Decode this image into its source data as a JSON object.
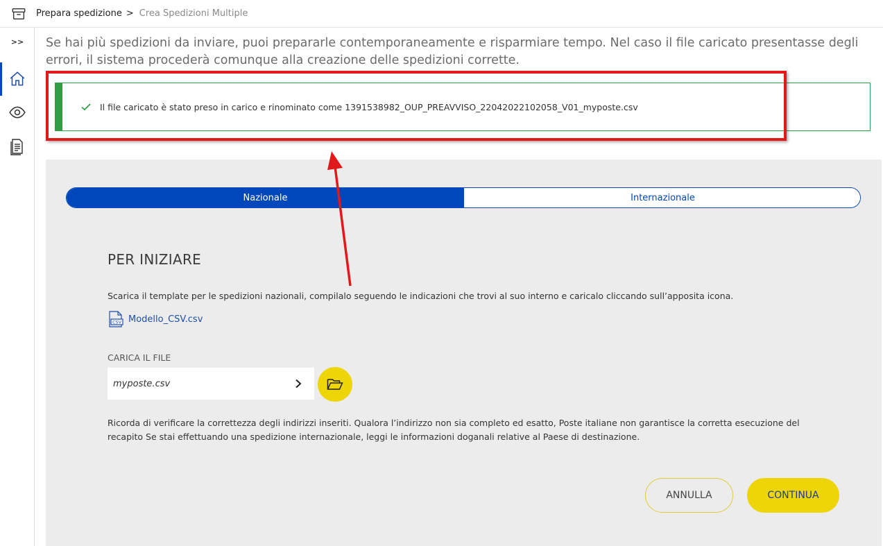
{
  "header": {
    "breadcrumb_main": "Prepara spedizione",
    "breadcrumb_sep": ">",
    "breadcrumb_current": "Crea Spedizioni Multiple",
    "icon": "archive-box-icon"
  },
  "sidebar": {
    "expand_label": ">>",
    "items": [
      {
        "icon": "home-icon",
        "active": true
      },
      {
        "icon": "eye-icon",
        "active": false
      },
      {
        "icon": "document-list-icon",
        "active": false
      }
    ]
  },
  "intro": {
    "text": "Se hai più spedizioni da inviare, puoi prepararle contemporaneamente e risparmiare tempo. Nel caso il file caricato presentasse degli errori, il sistema procederà comunque alla creazione delle spedizioni corrette."
  },
  "notification": {
    "type": "success",
    "message": "Il file caricato è stato preso in carico e rinominato come 1391538982_OUP_PREAVVISO_22042022102058_V01_myposte.csv",
    "icon": "check-icon"
  },
  "tabs": [
    {
      "label": "Nazionale",
      "active": true
    },
    {
      "label": "Internazionale",
      "active": false
    }
  ],
  "content": {
    "title": "PER INIZIARE",
    "description": "Scarica il template per le spedizioni nazionali, compilalo seguendo le indicazioni che trovi al suo interno e caricalo cliccando sull’apposita icona.",
    "template_link": "Modello_CSV.csv",
    "template_icon_text": "CSV",
    "upload_label": "CARICA IL FILE",
    "file_value": "myposte.csv",
    "note": "Ricorda di verificare la correttezza degli indirizzi inseriti. Qualora l’indirizzo non sia completo ed esatto, Poste italiane non garantisce la corretta esecuzione del recapito Se stai effettuando una spedizione internazionale, leggi le informazioni doganali relative al Paese di destinazione."
  },
  "actions": {
    "cancel_label": "ANNULLA",
    "continue_label": "CONTINUA"
  },
  "colors": {
    "brand_blue": "#0047bb",
    "accent_yellow": "#eed508",
    "success_green": "#2f9e44",
    "annotation_red": "#e0191b"
  }
}
